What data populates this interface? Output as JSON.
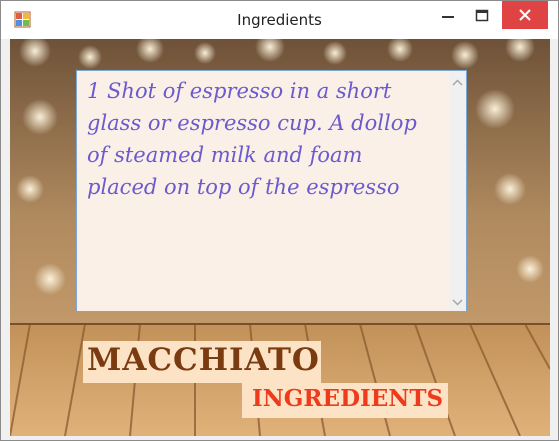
{
  "window": {
    "title": "Ingredients",
    "app_icon": "app-icon",
    "controls": {
      "minimize_icon": "minimize-icon",
      "maximize_icon": "maximize-icon",
      "close_icon": "close-icon",
      "close_color": "#e04343"
    }
  },
  "ingredients": {
    "text": "1 Shot of espresso in a short\nglass or espresso cup. A dollop\nof steamed milk and foam\nplaced on top of the espresso",
    "text_color": "#6a5acd",
    "background": "#faf0e8"
  },
  "labels": {
    "drink_name": "MACCHIATO",
    "drink_name_color": "#7a3b10",
    "subtitle": "INGREDIENTS",
    "subtitle_color": "#ee3b1c",
    "label_background": "#fde3c5"
  },
  "background": {
    "top_color": "#b08a5f",
    "table_color": "#d6a565"
  }
}
